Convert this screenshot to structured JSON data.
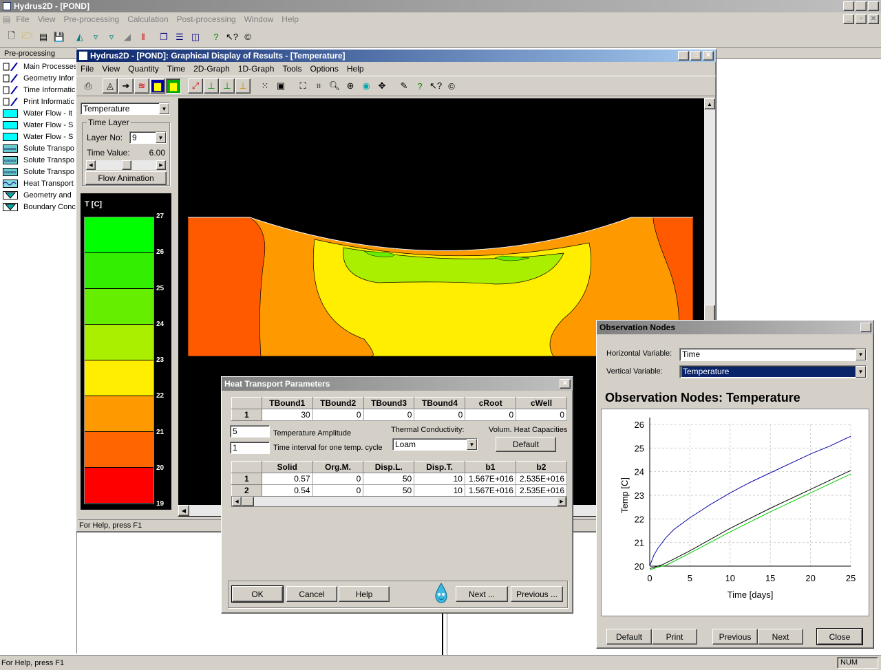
{
  "app": {
    "title": "Hydrus2D - [POND]",
    "menu": [
      "File",
      "View",
      "Pre-processing",
      "Calculation",
      "Post-processing",
      "Window",
      "Help"
    ],
    "status": "For Help, press F1",
    "num": "NUM"
  },
  "sidebar": {
    "title": "Pre-processing",
    "items": [
      {
        "label": "Main Processes",
        "icon": "pencil-icon"
      },
      {
        "label": "Geometry Infor",
        "icon": "pencil-icon"
      },
      {
        "label": "Time Informatic",
        "icon": "pencil-icon"
      },
      {
        "label": "Print Informatic",
        "icon": "pencil-icon"
      },
      {
        "label": "Water Flow - It",
        "icon": "water-flow-icon"
      },
      {
        "label": "Water Flow - S",
        "icon": "water-flow-icon"
      },
      {
        "label": "Water Flow - S",
        "icon": "water-flow-icon"
      },
      {
        "label": "Solute Transpo",
        "icon": "solute-icon"
      },
      {
        "label": "Solute Transpo",
        "icon": "solute-icon"
      },
      {
        "label": "Solute Transpo",
        "icon": "solute-icon"
      },
      {
        "label": "Heat Transport",
        "icon": "heat-icon"
      },
      {
        "label": "Geometry and",
        "icon": "geometry-icon"
      },
      {
        "label": "Boundary Conc",
        "icon": "geometry-icon"
      }
    ]
  },
  "graph": {
    "title": "Hydrus2D - [POND]: Graphical Display of Results - [Temperature]",
    "menu": [
      "File",
      "View",
      "Quantity",
      "Time",
      "2D-Graph",
      "1D-Graph",
      "Tools",
      "Options",
      "Help"
    ],
    "quantity": "Temperature",
    "time_layer_label": "Time Layer",
    "layer_no_label": "Layer No:",
    "layer_no": "9",
    "time_value_label": "Time Value:",
    "time_value": "6.00",
    "flow_animation": "Flow Animation",
    "legend_title": "T [C]",
    "legend_ticks": [
      "27",
      "26",
      "25",
      "24",
      "23",
      "22",
      "21",
      "20",
      "19"
    ],
    "legend_colors": [
      "#00ff00",
      "#33ee00",
      "#66ee00",
      "#aaee00",
      "#ffee00",
      "#ff9900",
      "#ff6600",
      "#ff0000"
    ],
    "status": "For Help, press F1"
  },
  "heat": {
    "title": "Heat Transport Parameters",
    "tbound_headers": [
      "",
      "TBound1",
      "TBound2",
      "TBound3",
      "TBound4",
      "cRoot",
      "cWell"
    ],
    "tbound_rows": [
      [
        "1",
        "30",
        "0",
        "0",
        "0",
        "0",
        "0"
      ]
    ],
    "temp_amplitude": "5",
    "temp_amplitude_label": "Temperature Amplitude",
    "interval": "1",
    "interval_label": "Time interval for one temp. cycle",
    "thermal_label": "Thermal Conductivity:",
    "thermal_value": "Loam",
    "volum_label": "Volum. Heat Capacities",
    "default_btn": "Default",
    "mat_headers": [
      "",
      "Solid",
      "Org.M.",
      "Disp.L.",
      "Disp.T.",
      "b1",
      "b2"
    ],
    "mat_rows": [
      [
        "1",
        "0.57",
        "0",
        "50",
        "10",
        "1.567E+016",
        "2.535E+016"
      ],
      [
        "2",
        "0.54",
        "0",
        "50",
        "10",
        "1.567E+016",
        "2.535E+016"
      ]
    ],
    "ok": "OK",
    "cancel": "Cancel",
    "help": "Help",
    "next": "Next ...",
    "previous": "Previous ..."
  },
  "obs": {
    "title": "Observation Nodes",
    "hvar_label": "Horizontal Variable:",
    "hvar": "Time",
    "vvar_label": "Vertical Variable:",
    "vvar": "Temperature",
    "chart_title": "Observation Nodes: Temperature",
    "buttons": [
      "Default",
      "Print",
      "Previous",
      "Next",
      "Close"
    ]
  },
  "chart_data": {
    "type": "line",
    "title": "",
    "xlabel": "Time [days]",
    "ylabel": "Temp [C]",
    "xlim": [
      0,
      25
    ],
    "ylim": [
      20,
      26
    ],
    "xticks": [
      0,
      5,
      10,
      15,
      20,
      25
    ],
    "yticks": [
      20,
      21,
      22,
      23,
      24,
      25,
      26
    ],
    "grid": true,
    "series": [
      {
        "color": "#0000aa",
        "x": [
          0,
          0.5,
          1,
          2,
          3,
          5,
          7.5,
          10,
          12.5,
          15,
          17.5,
          20,
          22.5,
          25
        ],
        "y": [
          20.0,
          20.45,
          20.75,
          21.2,
          21.55,
          22.05,
          22.6,
          23.1,
          23.55,
          23.95,
          24.35,
          24.75,
          25.1,
          25.5
        ]
      },
      {
        "color": "#000000",
        "x": [
          0,
          0.5,
          1,
          1.5,
          3,
          5,
          10,
          15,
          20,
          25
        ],
        "y": [
          19.9,
          19.95,
          20.0,
          20.05,
          20.3,
          20.65,
          21.6,
          22.45,
          23.25,
          24.05
        ]
      },
      {
        "color": "#00cc00",
        "x": [
          0,
          1,
          1.5,
          2,
          3,
          5,
          10,
          15,
          20,
          25
        ],
        "y": [
          19.85,
          19.95,
          20.0,
          20.03,
          20.2,
          20.55,
          21.45,
          22.3,
          23.1,
          23.9
        ]
      }
    ]
  }
}
